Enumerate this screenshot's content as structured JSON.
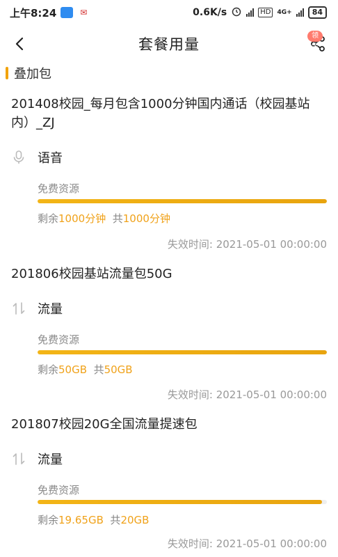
{
  "status_bar": {
    "time": "上午8:24",
    "net_speed": "0.6K/s",
    "hd": "HD",
    "net_type": "4G+",
    "battery": "84"
  },
  "header": {
    "title": "套餐用量",
    "badge": "领金豆"
  },
  "section": {
    "label": "叠加包"
  },
  "packages": [
    {
      "title": "201408校园_每月包含1000分钟国内通话（校园基站内）_ZJ",
      "resource_name": "语音",
      "resource_icon": "microphone-icon",
      "free_label": "免费资源",
      "remaining_prefix": "剩余",
      "remaining": "1000分钟",
      "total_prefix": "共",
      "total": "1000分钟",
      "fill_fraction": 1.0,
      "expire_label": "失效时间: ",
      "expire": "2021-05-01 00:00:00"
    },
    {
      "title": "201806校园基站流量包50G",
      "resource_name": "流量",
      "resource_icon": "data-transfer-icon",
      "free_label": "免费资源",
      "remaining_prefix": "剩余",
      "remaining": "50GB",
      "total_prefix": "共",
      "total": "50GB",
      "fill_fraction": 1.0,
      "expire_label": "失效时间: ",
      "expire": "2021-05-01 00:00:00"
    },
    {
      "title": "201807校园20G全国流量提速包",
      "resource_name": "流量",
      "resource_icon": "data-transfer-icon",
      "free_label": "免费资源",
      "remaining_prefix": "剩余",
      "remaining": "19.65GB",
      "total_prefix": "共",
      "total": "20GB",
      "fill_fraction": 0.9825,
      "expire_label": "失效时间: ",
      "expire": "2021-05-01 00:00:00"
    }
  ],
  "colors": {
    "accent": "#f0a21a",
    "section_bar": "#f2a30b"
  }
}
